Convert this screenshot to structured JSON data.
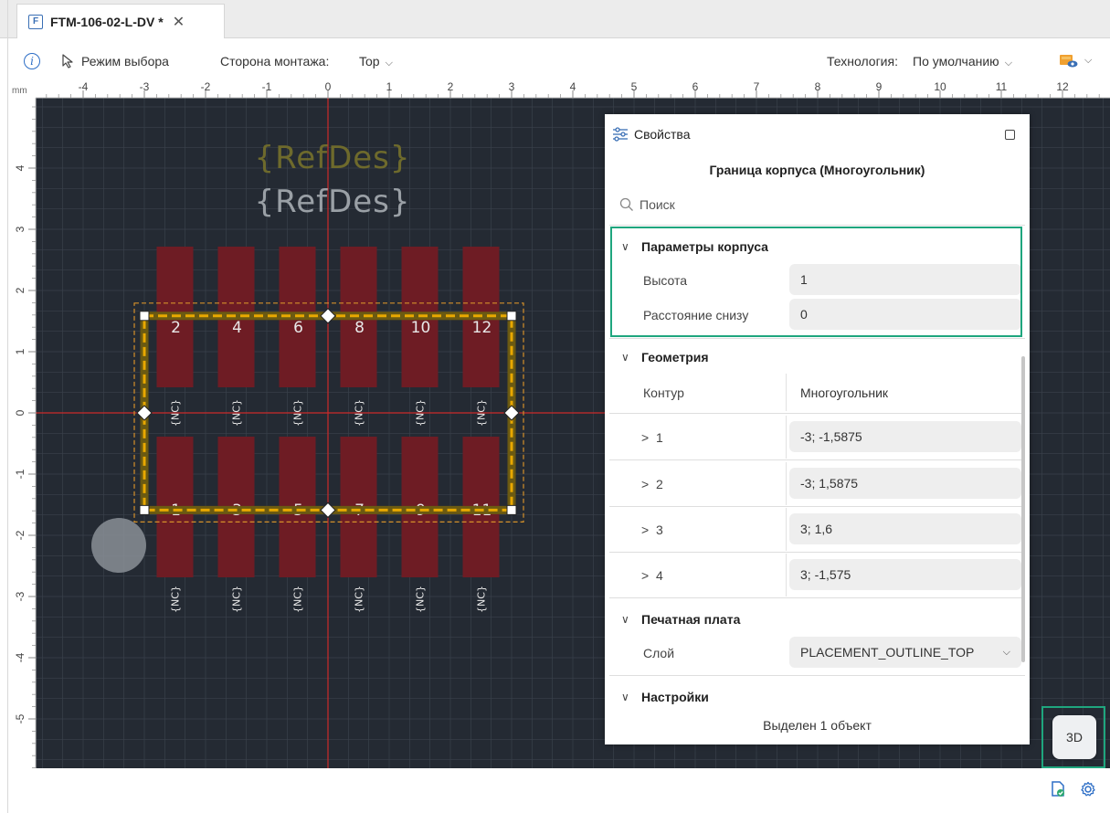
{
  "tab": {
    "icon": "F",
    "title": "FTM-106-02-L-DV *",
    "close": "✕"
  },
  "toolbar": {
    "mode_label": "Режим выбора",
    "side_label": "Сторона монтажа:",
    "side_value": "Top",
    "tech_label": "Технология:",
    "tech_value": "По умолчанию"
  },
  "canvas": {
    "unit": "mm",
    "x_ticks": [
      "-4",
      "-3",
      "-2",
      "-1",
      "0",
      "1",
      "2",
      "3",
      "4",
      "5",
      "6",
      "7",
      "8",
      "9",
      "10",
      "11",
      "12"
    ],
    "y_ticks": [
      "4",
      "3",
      "2",
      "1",
      "0",
      "-1",
      "-2",
      "-3",
      "-4",
      "-5"
    ],
    "refdes": [
      "{RefDes}",
      "{RefDes}"
    ],
    "pins_top": [
      "2",
      "4",
      "6",
      "8",
      "10",
      "12"
    ],
    "pins_bottom": [
      "1",
      "3",
      "5",
      "7",
      "9",
      "11"
    ],
    "nc_label": "{NC}",
    "colors": {
      "background": "#242a33",
      "pad": "#6e1c24",
      "outline": "#e8a800",
      "crosshair": "#cc2a2a",
      "refdes_top": "#6e6a2c",
      "refdes_bottom": "#9aa0a6"
    }
  },
  "panel": {
    "title": "Свойства",
    "subtitle": "Граница корпуса (Многоугольник)",
    "search_placeholder": "Поиск",
    "sections": {
      "body": {
        "title": "Параметры корпуса",
        "height_label": "Высота",
        "height_value": "1",
        "standoff_label": "Расстояние снизу",
        "standoff_value": "0"
      },
      "geometry": {
        "title": "Геометрия",
        "contour_label": "Контур",
        "contour_value": "Многоугольник",
        "points": [
          {
            "label": "1",
            "value": "-3; -1,5875"
          },
          {
            "label": "2",
            "value": "-3; 1,5875"
          },
          {
            "label": "3",
            "value": "3; 1,6"
          },
          {
            "label": "4",
            "value": "3; -1,575"
          }
        ]
      },
      "board": {
        "title": "Печатная плата",
        "layer_label": "Слой",
        "layer_value": "PLACEMENT_OUTLINE_TOP"
      },
      "settings": {
        "title": "Настройки"
      }
    },
    "status": "Выделен 1 объект"
  },
  "view3d": {
    "label": "3D"
  }
}
